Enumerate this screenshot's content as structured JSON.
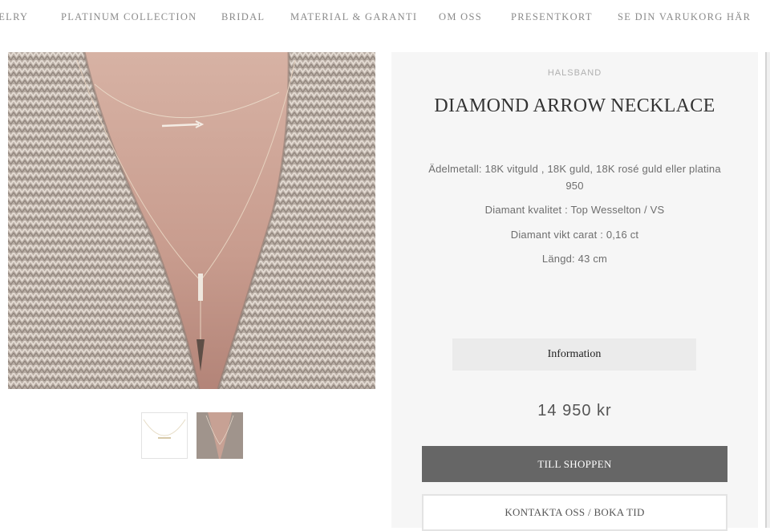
{
  "nav": {
    "items": [
      "JEWELRY",
      "PLATINUM COLLECTION",
      "BRIDAL",
      "MATERIAL & GARANTI",
      "OM OSS",
      "PRESENTKORT",
      "SE DIN VARUKORG HÄR"
    ]
  },
  "gallery": {
    "main_image": "necklace-worn-knit-cardigan-photo",
    "thumbnails": [
      "necklace-product-thumbnail",
      "necklace-worn-thumbnail"
    ]
  },
  "product": {
    "category": "HALSBAND",
    "title": "DIAMOND ARROW NECKLACE",
    "specs": [
      "Ädelmetall: 18K vitguld , 18K guld, 18K rosé guld eller platina 950",
      "Diamant kvalitet : Top Wesselton / VS",
      "Diamant vikt carat : 0,16 ct",
      "Längd: 43 cm"
    ],
    "info_button": "Information",
    "price": "14 950 kr",
    "shop_button": "TILL SHOPPEN",
    "contact_button": "KONTAKTA OSS / BOKA TID"
  },
  "colors": {
    "panel_bg": "#f6f6f6",
    "shop_button_bg": "#666666",
    "nav_text": "#8a8a8a"
  }
}
